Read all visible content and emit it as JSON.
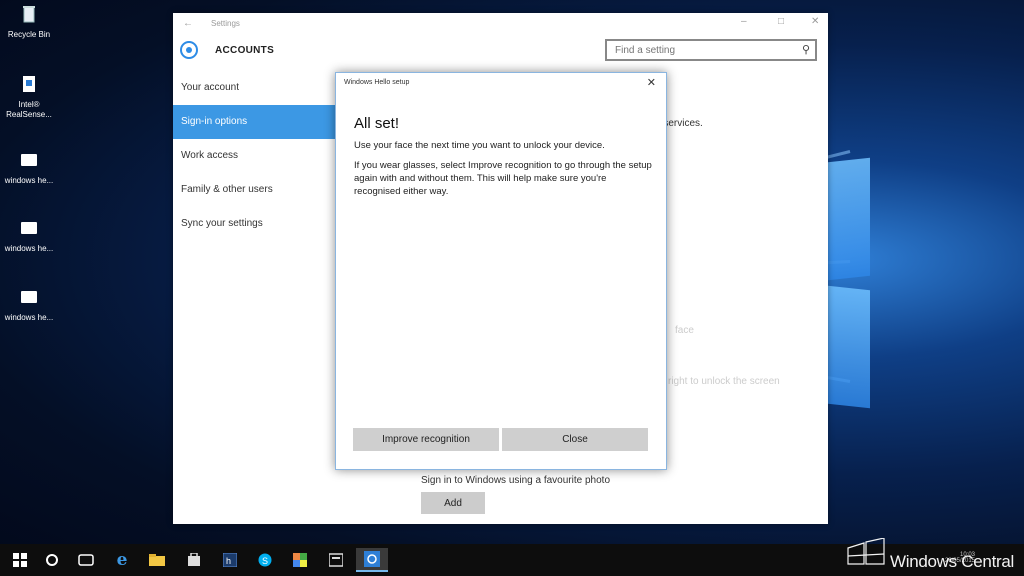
{
  "desktop": {
    "icons": [
      {
        "label": "Recycle Bin"
      },
      {
        "label": "Intel® RealSense..."
      },
      {
        "label": "windows he..."
      },
      {
        "label": "windows he..."
      },
      {
        "label": "windows he..."
      }
    ]
  },
  "settings": {
    "window_title": "Settings",
    "section_title": "ACCOUNTS",
    "search_placeholder": "Find a setting",
    "nav": [
      {
        "label": "Your account",
        "active": false
      },
      {
        "label": "Sign-in options",
        "active": true
      },
      {
        "label": "Work access",
        "active": false
      },
      {
        "label": "Family & other users",
        "active": false
      },
      {
        "label": "Sync your settings",
        "active": false
      }
    ],
    "content": {
      "partial_services": "d services.",
      "partial_face": "face",
      "partial_right": "right to unlock the screen",
      "picture_password_desc": "Sign in to Windows using a favourite photo",
      "add_button": "Add"
    }
  },
  "hello_dialog": {
    "title": "Windows Hello setup",
    "heading": "All set!",
    "paragraph1": "Use your face the next time you want to unlock your device.",
    "paragraph2": "If you wear glasses, select Improve recognition to go through the setup again with and without them. This will help make sure you're recognised either way.",
    "improve_button": "Improve recognition",
    "close_button": "Close"
  },
  "taskbar": {
    "watermark": "Windows Central",
    "tray_time": "10:03",
    "tray_date": "26/05/2015"
  },
  "colors": {
    "accent": "#3c98e4",
    "taskbar": "#0d0d0d",
    "desktop": "#07204d"
  }
}
